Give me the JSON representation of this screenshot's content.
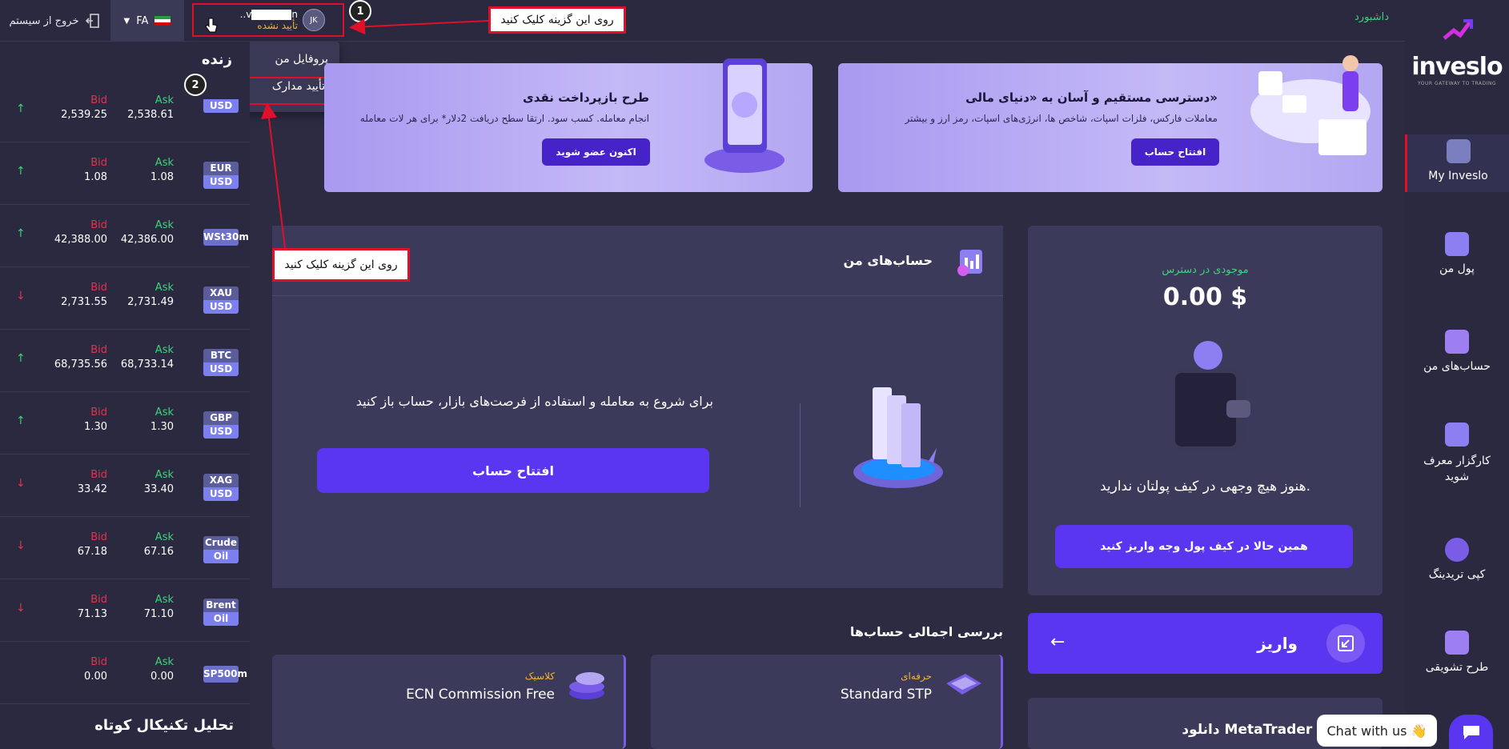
{
  "topbar": {
    "logout_label": "خروج از سیستم",
    "lang": "FA",
    "avatar_initials": "JK",
    "user_status": "تأیید نشده",
    "dashboard_link": "داشبورد"
  },
  "annotations": {
    "badge1": "1",
    "badge2": "2",
    "callout_text": "روی این گزینه کلیک کنید"
  },
  "dropdown": {
    "profile": "پروفایل من",
    "verify_docs": "تأیید مدارک"
  },
  "market": {
    "title": "زنده",
    "bid_label": "Bid",
    "ask_label": "Ask",
    "rows": [
      {
        "sym_top": "",
        "sym_bottom": "USD",
        "bid": "2,539.25",
        "ask": "2,538.61",
        "dir": "up"
      },
      {
        "sym_top": "EUR",
        "sym_bottom": "USD",
        "bid": "1.08",
        "ask": "1.08",
        "dir": "up"
      },
      {
        "sym_single": "WSt30m",
        "bid": "42,388.00",
        "ask": "42,386.00",
        "dir": "up"
      },
      {
        "sym_top": "XAU",
        "sym_bottom": "USD",
        "bid": "2,731.55",
        "ask": "2,731.49",
        "dir": "down"
      },
      {
        "sym_top": "BTC",
        "sym_bottom": "USD",
        "bid": "68,735.56",
        "ask": "68,733.14",
        "dir": "up"
      },
      {
        "sym_top": "GBP",
        "sym_bottom": "USD",
        "bid": "1.30",
        "ask": "1.30",
        "dir": "up"
      },
      {
        "sym_top": "XAG",
        "sym_bottom": "USD",
        "bid": "33.42",
        "ask": "33.40",
        "dir": "down"
      },
      {
        "sym_top": "Crude",
        "sym_bottom": "Oil",
        "bid": "67.18",
        "ask": "67.16",
        "dir": "down"
      },
      {
        "sym_top": "Brent",
        "sym_bottom": "Oil",
        "bid": "71.13",
        "ask": "71.10",
        "dir": "down"
      },
      {
        "sym_single": "SP500m",
        "bid": "0.00",
        "ask": "0.00",
        "dir": "none"
      }
    ],
    "tech_title": "تحلیل تکنیکال کوتاه"
  },
  "sidebar": {
    "logo_text": "inveslo",
    "logo_sub": "YOUR GATEWAY TO TRADING",
    "items": [
      {
        "label": "My Inveslo"
      },
      {
        "label": "پول من"
      },
      {
        "label": "حساب‌های من"
      },
      {
        "label_line1": "کارگزار معرف",
        "label_line2": "شوید"
      },
      {
        "label": "کپی تریدینگ"
      },
      {
        "label": "طرح تشویقی"
      }
    ]
  },
  "banners": {
    "left": {
      "title": "طرح بازپرداخت نقدی",
      "sub": "انجام معامله. کسب سود. ارتقا سطح دریافت 2دلار* برای هر لات معامله",
      "button": "اکنون عضو شوید"
    },
    "right": {
      "title": "دسترسی مستقیم و آسان به «دنیای مالی»",
      "sub": "معاملات فارکس، فلزات اسپات، شاخص ها، انرژی‌های اسپات، رمز ارز و بیشتر",
      "button": "افتتاح حساب"
    }
  },
  "accounts": {
    "title": "حساب‌های من",
    "prompt": "برای شروع به معامله و استفاده از فرصت‌های بازار، حساب باز کنید",
    "button": "افتتاح حساب"
  },
  "wallet": {
    "label": "موجودی در دسترس",
    "balance": "0.00 $",
    "empty_text": "هنوز هیچ وجهی در کیف پولتان ندارید.",
    "button": "همین حالا در کیف پول وجه واریز کنید"
  },
  "deposit": {
    "label": "واریز",
    "arrow": "←"
  },
  "overview": {
    "title": "بررسی اجمالی حساب‌ها",
    "cards": [
      {
        "tag": "حرفه‌ای",
        "name": "Standard STP"
      },
      {
        "tag": "کلاسیک",
        "name": "ECN Commission Free"
      }
    ]
  },
  "download": {
    "title": "دانلود MetaTrader 4"
  },
  "chat": {
    "label": "Chat with us 👋"
  },
  "colors": {
    "accent": "#5a36f0",
    "up": "#3fd27b",
    "down": "#e0344c",
    "annot": "#e0102a"
  }
}
